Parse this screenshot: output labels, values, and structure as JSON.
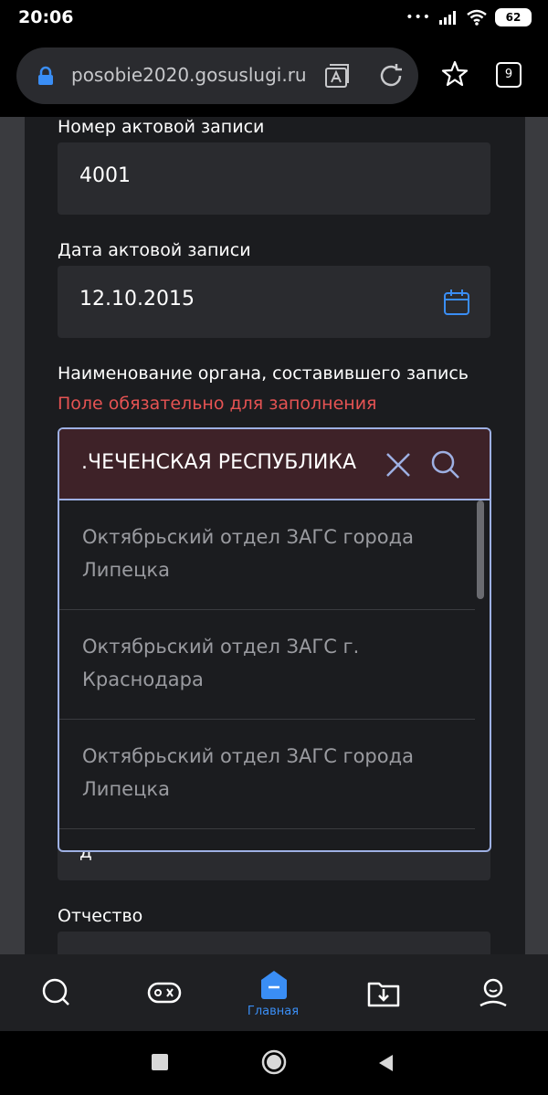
{
  "status": {
    "time": "20:06",
    "battery": "62",
    "icons": [
      "dots-icon",
      "signal-icon",
      "wifi-icon",
      "battery-icon"
    ]
  },
  "browser": {
    "url": "posobie2020.gosuslugi.ru",
    "tabs_count": "9"
  },
  "form": {
    "record_number": {
      "label": "Номер актовой записи",
      "value": "4001"
    },
    "record_date": {
      "label": "Дата актовой записи",
      "value": "12.10.2015"
    },
    "organ": {
      "label": "Наименование органа, составившего запись",
      "error": "Поле обязательно для заполнения",
      "search_value": ".ЧЕЧЕНСКАЯ РЕСПУБЛИКА",
      "options": [
        "Октябрьский отдел ЗАГС города Липецка",
        "Октябрьский отдел ЗАГС г. Краснодара",
        "Октябрьский отдел ЗАГС города Липецка"
      ]
    },
    "under_field_partial": "д",
    "patronymic": {
      "label": "Отчество"
    }
  },
  "bottom_nav": {
    "active_label": "Главная",
    "accent": "#3a8ef5"
  },
  "colors": {
    "error": "#e65353",
    "focus_border": "#9eb0e3",
    "search_bg": "#3e2228"
  }
}
